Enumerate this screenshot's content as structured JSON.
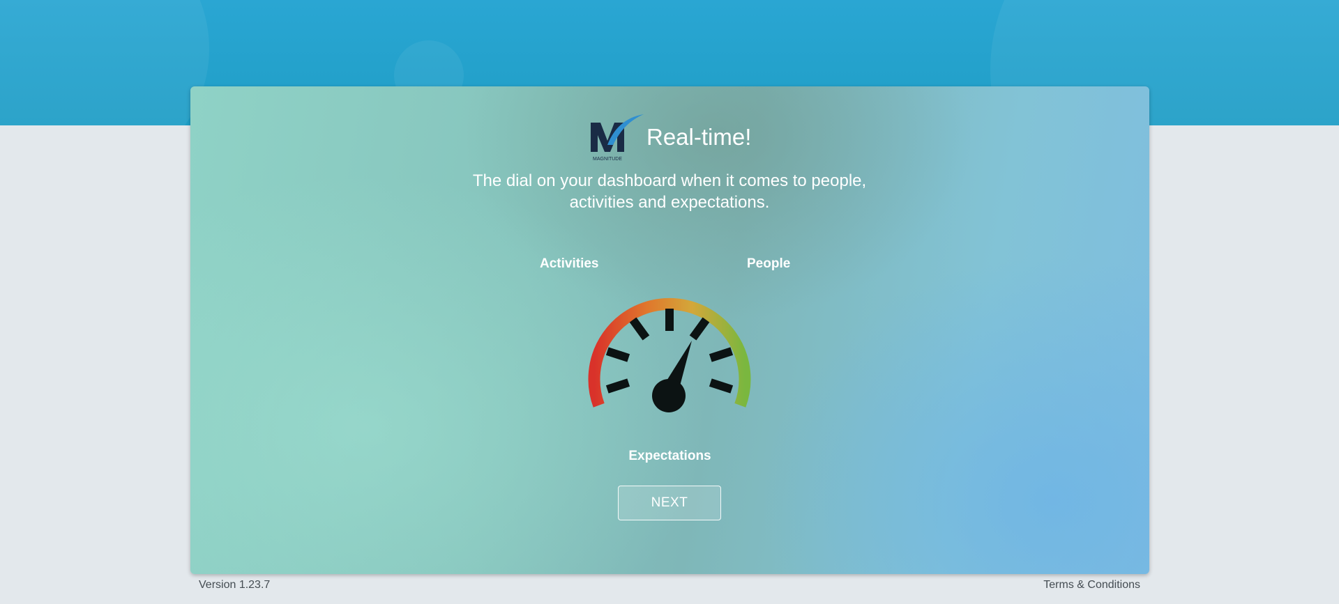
{
  "header": {
    "title": "Real-time!",
    "subtitle": "The dial on your dashboard when it comes to people, activities and expectations.",
    "logo_text": "MAGNITUDE"
  },
  "gauge": {
    "labels": {
      "activities": "Activities",
      "people": "People",
      "expectations": "Expectations"
    },
    "arc_colors": [
      "#d9322a",
      "#e0772c",
      "#d3a73a",
      "#7ab73f"
    ],
    "tick_color": "#0c1313"
  },
  "actions": {
    "next_label": "NEXT"
  },
  "footer": {
    "version": "Version 1.23.7",
    "terms": "Terms & Conditions"
  },
  "colors": {
    "header_band": "#1f9ec6",
    "page_background": "#e3e8ec",
    "text_on_card": "#ffffff"
  }
}
